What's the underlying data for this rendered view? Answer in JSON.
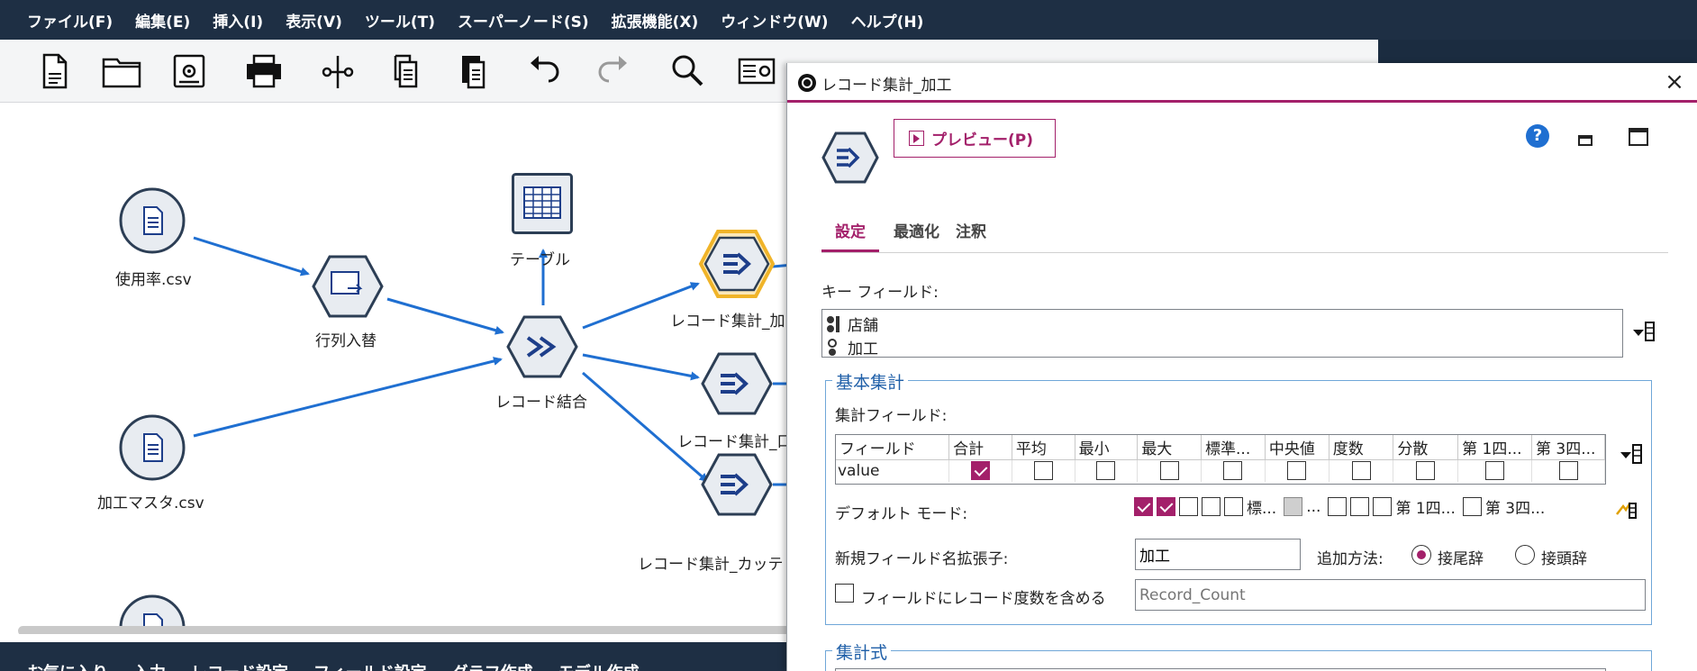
{
  "menubar": {
    "items": [
      "ファイル(F)",
      "編集(E)",
      "挿入(I)",
      "表示(V)",
      "ツール(T)",
      "スーパーノード(S)",
      "拡張機能(X)",
      "ウィンドウ(W)",
      "ヘルプ(H)"
    ]
  },
  "toolbar": {
    "icons": [
      "new-file-icon",
      "open-folder-icon",
      "save-icon",
      "print-icon",
      "cut-icon",
      "copy-icon",
      "paste-icon",
      "undo-icon",
      "redo-icon",
      "search-icon",
      "properties-icon"
    ]
  },
  "canvas": {
    "nodes": {
      "usage_csv": "使用率.csv",
      "transpose": "行列入替",
      "table": "テーブル",
      "merge": "レコード結合",
      "agg_process": "レコード集計_加",
      "agg_2": "レコード集計_口",
      "agg_category": "レコード集計_カッテ",
      "process_master_csv": "加工マスタ.csv"
    }
  },
  "palette": {
    "tabs": [
      "お気に入り",
      "入力",
      "レコード設定",
      "フィールド設定",
      "グラフ作成",
      "モデル作成"
    ]
  },
  "dialog": {
    "title": "レコード集計_加工",
    "preview_label": "プレビュー(P)",
    "help_label": "?",
    "close_label": "×",
    "tabs": [
      "設定",
      "最適化",
      "注釈"
    ],
    "key_fields_label": "キー フィールド:",
    "key_fields": [
      "店舗",
      "加工"
    ],
    "basic_group_title": "基本集計",
    "agg_fields_label": "集計フィールド:",
    "agg_columns": [
      "フィールド",
      "合計",
      "平均",
      "最小",
      "最大",
      "標準...",
      "中央値",
      "度数",
      "分散",
      "第 1四...",
      "第 3四..."
    ],
    "agg_row": {
      "field": "value",
      "checks": [
        true,
        false,
        false,
        false,
        false,
        false,
        false,
        false,
        false,
        false
      ]
    },
    "default_mode_label": "デフォルト モード:",
    "default_mode_texts": [
      "標...",
      "...",
      "第 1四...",
      "第 3四..."
    ],
    "new_field_suffix_label": "新規フィールド名拡張子:",
    "new_field_suffix_value": "加工",
    "add_method_label": "追加方法:",
    "suffix_label": "接尾辞",
    "prefix_label": "接頭辞",
    "include_count_label": "フィールドにレコード度数を含める",
    "record_count_placeholder": "Record_Count",
    "expr_group_title": "集計式"
  },
  "colors": {
    "accent": "#a3206a",
    "menubar": "#1e2f44",
    "link": "#1f6fd1",
    "group_border": "#6fa7d8"
  }
}
